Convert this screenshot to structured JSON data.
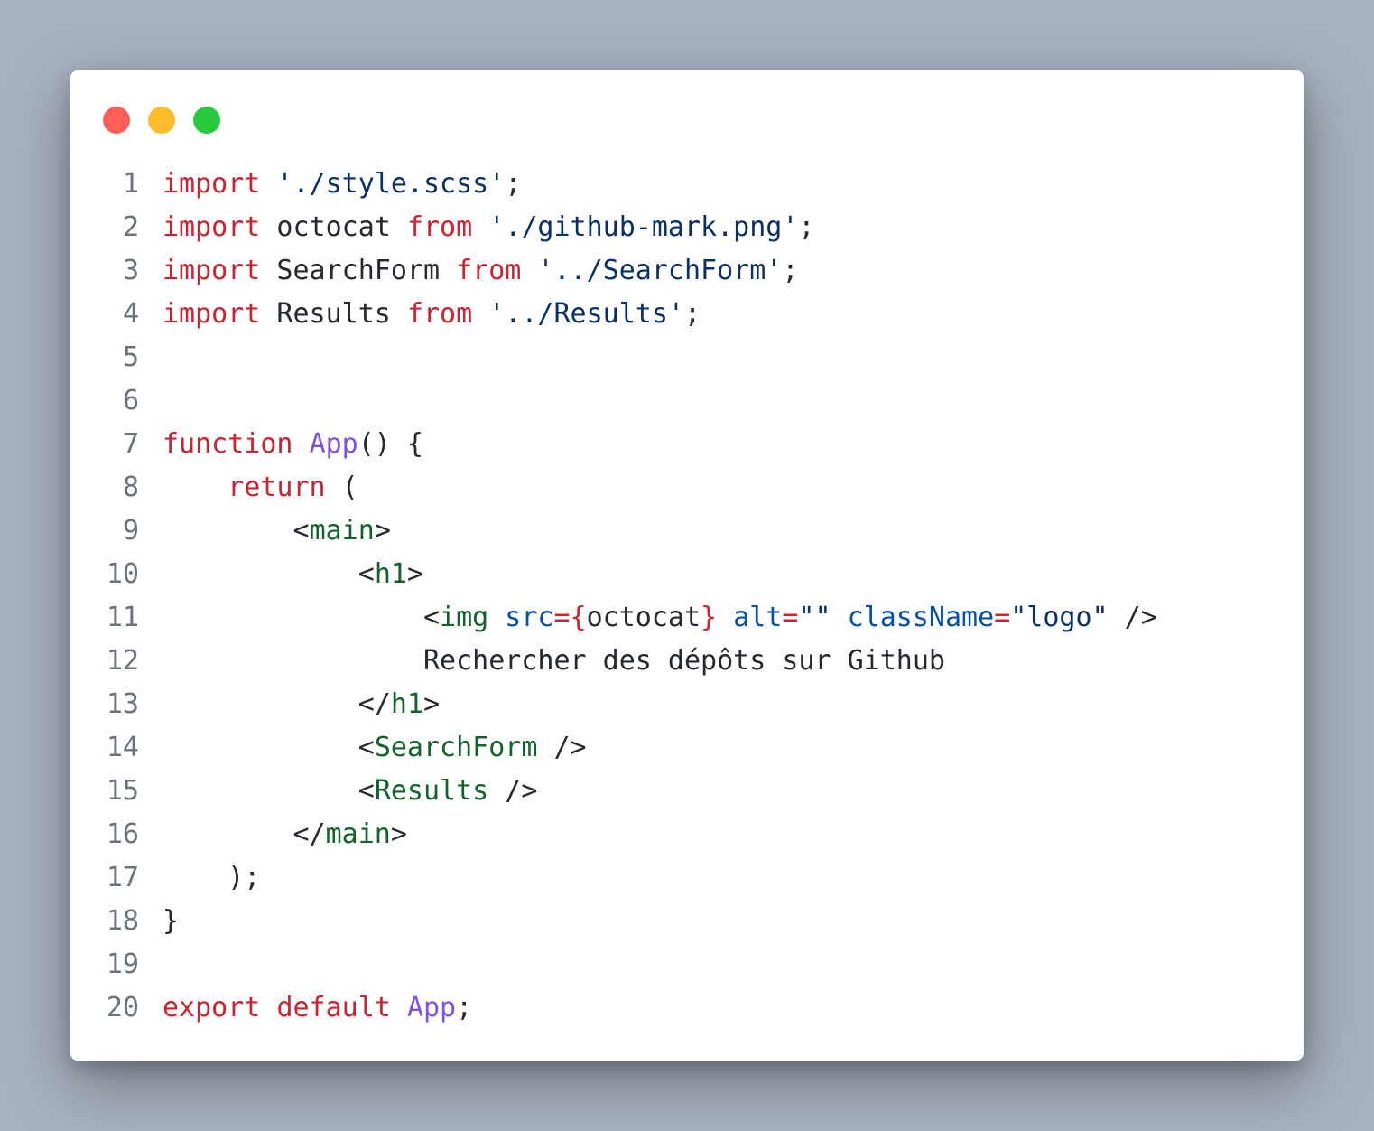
{
  "window": {
    "controls": [
      {
        "name": "close",
        "color": "#ff5f56"
      },
      {
        "name": "minimize",
        "color": "#ffbd2e"
      },
      {
        "name": "maximize",
        "color": "#27c93f"
      }
    ]
  },
  "colors": {
    "background": "#a8b2bf",
    "text": "#24292f",
    "line_number": "#6a737d",
    "keyword": "#cf222e",
    "string": "#0a3069",
    "function": "#8250df",
    "tag": "#116329",
    "attribute": "#0550ae"
  },
  "code": {
    "lines": [
      {
        "n": "1",
        "tokens": [
          {
            "t": "import",
            "k": "keyword"
          },
          {
            "t": " ",
            "k": "plain"
          },
          {
            "t": "'./style.scss'",
            "k": "string"
          },
          {
            "t": ";",
            "k": "plain"
          }
        ]
      },
      {
        "n": "2",
        "tokens": [
          {
            "t": "import",
            "k": "keyword"
          },
          {
            "t": " octocat ",
            "k": "plain"
          },
          {
            "t": "from",
            "k": "keyword"
          },
          {
            "t": " ",
            "k": "plain"
          },
          {
            "t": "'./github-mark.png'",
            "k": "string"
          },
          {
            "t": ";",
            "k": "plain"
          }
        ]
      },
      {
        "n": "3",
        "tokens": [
          {
            "t": "import",
            "k": "keyword"
          },
          {
            "t": " SearchForm ",
            "k": "plain"
          },
          {
            "t": "from",
            "k": "keyword"
          },
          {
            "t": " ",
            "k": "plain"
          },
          {
            "t": "'../SearchForm'",
            "k": "string"
          },
          {
            "t": ";",
            "k": "plain"
          }
        ]
      },
      {
        "n": "4",
        "tokens": [
          {
            "t": "import",
            "k": "keyword"
          },
          {
            "t": " Results ",
            "k": "plain"
          },
          {
            "t": "from",
            "k": "keyword"
          },
          {
            "t": " ",
            "k": "plain"
          },
          {
            "t": "'../Results'",
            "k": "string"
          },
          {
            "t": ";",
            "k": "plain"
          }
        ]
      },
      {
        "n": "5",
        "tokens": []
      },
      {
        "n": "6",
        "tokens": []
      },
      {
        "n": "7",
        "tokens": [
          {
            "t": "function",
            "k": "keyword"
          },
          {
            "t": " ",
            "k": "plain"
          },
          {
            "t": "App",
            "k": "function"
          },
          {
            "t": "() {",
            "k": "plain"
          }
        ]
      },
      {
        "n": "8",
        "tokens": [
          {
            "t": "    ",
            "k": "plain"
          },
          {
            "t": "return",
            "k": "keyword"
          },
          {
            "t": " (",
            "k": "plain"
          }
        ]
      },
      {
        "n": "9",
        "tokens": [
          {
            "t": "        <",
            "k": "plain"
          },
          {
            "t": "main",
            "k": "tag"
          },
          {
            "t": ">",
            "k": "plain"
          }
        ]
      },
      {
        "n": "10",
        "tokens": [
          {
            "t": "            <",
            "k": "plain"
          },
          {
            "t": "h1",
            "k": "tag"
          },
          {
            "t": ">",
            "k": "plain"
          }
        ]
      },
      {
        "n": "11",
        "tokens": [
          {
            "t": "                <",
            "k": "plain"
          },
          {
            "t": "img",
            "k": "tag"
          },
          {
            "t": " ",
            "k": "plain"
          },
          {
            "t": "src",
            "k": "attribute"
          },
          {
            "t": "={",
            "k": "keyword"
          },
          {
            "t": "octocat",
            "k": "plain"
          },
          {
            "t": "}",
            "k": "keyword"
          },
          {
            "t": " ",
            "k": "plain"
          },
          {
            "t": "alt",
            "k": "attribute"
          },
          {
            "t": "=",
            "k": "keyword"
          },
          {
            "t": "\"\"",
            "k": "string"
          },
          {
            "t": " ",
            "k": "plain"
          },
          {
            "t": "className",
            "k": "attribute"
          },
          {
            "t": "=",
            "k": "keyword"
          },
          {
            "t": "\"logo\"",
            "k": "string"
          },
          {
            "t": " />",
            "k": "plain"
          }
        ]
      },
      {
        "n": "12",
        "tokens": [
          {
            "t": "                Rechercher des dépôts sur Github",
            "k": "plain"
          }
        ]
      },
      {
        "n": "13",
        "tokens": [
          {
            "t": "            </",
            "k": "plain"
          },
          {
            "t": "h1",
            "k": "tag"
          },
          {
            "t": ">",
            "k": "plain"
          }
        ]
      },
      {
        "n": "14",
        "tokens": [
          {
            "t": "            <",
            "k": "plain"
          },
          {
            "t": "SearchForm",
            "k": "tag"
          },
          {
            "t": " />",
            "k": "plain"
          }
        ]
      },
      {
        "n": "15",
        "tokens": [
          {
            "t": "            <",
            "k": "plain"
          },
          {
            "t": "Results",
            "k": "tag"
          },
          {
            "t": " />",
            "k": "plain"
          }
        ]
      },
      {
        "n": "16",
        "tokens": [
          {
            "t": "        </",
            "k": "plain"
          },
          {
            "t": "main",
            "k": "tag"
          },
          {
            "t": ">",
            "k": "plain"
          }
        ]
      },
      {
        "n": "17",
        "tokens": [
          {
            "t": "    );",
            "k": "plain"
          }
        ]
      },
      {
        "n": "18",
        "tokens": [
          {
            "t": "}",
            "k": "plain"
          }
        ]
      },
      {
        "n": "19",
        "tokens": []
      },
      {
        "n": "20",
        "tokens": [
          {
            "t": "export",
            "k": "keyword"
          },
          {
            "t": " ",
            "k": "plain"
          },
          {
            "t": "default",
            "k": "keyword"
          },
          {
            "t": " ",
            "k": "plain"
          },
          {
            "t": "App",
            "k": "function"
          },
          {
            "t": ";",
            "k": "plain"
          }
        ]
      }
    ]
  }
}
